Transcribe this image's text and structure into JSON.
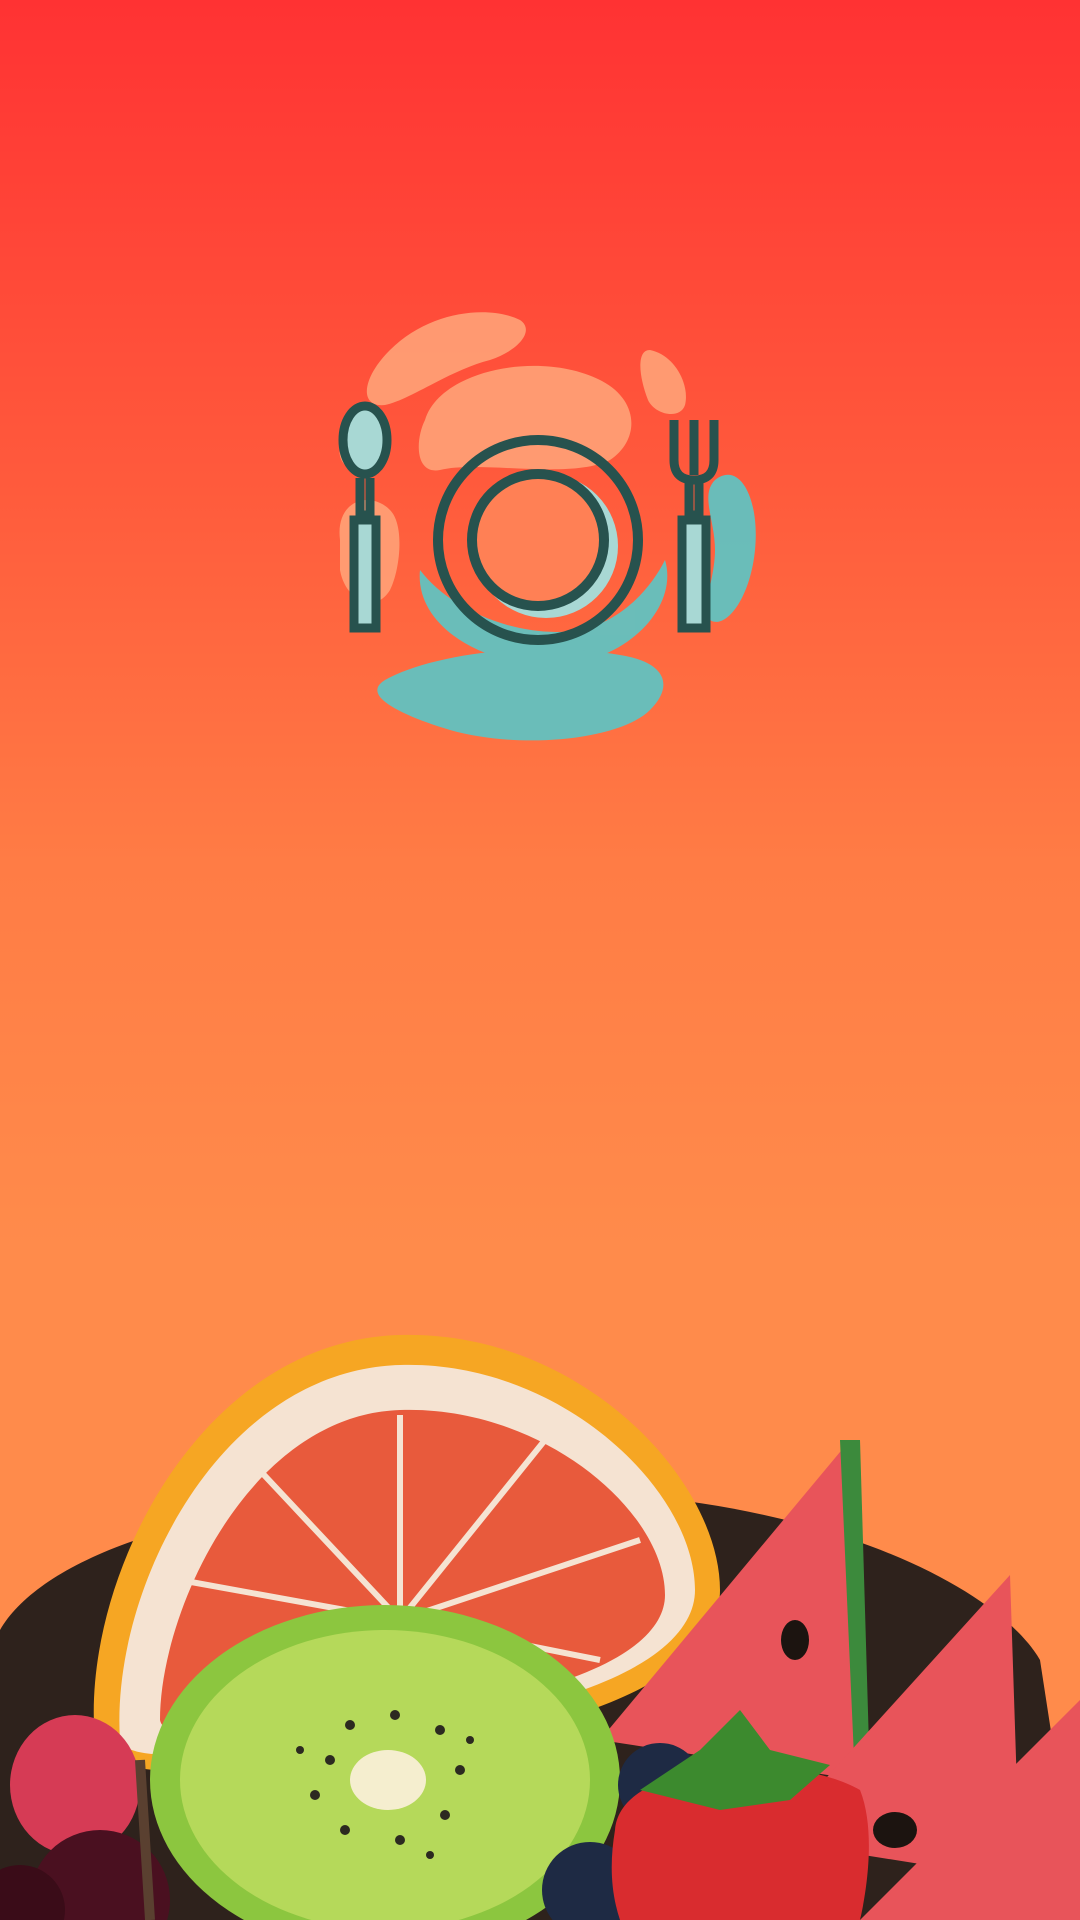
{
  "screen": {
    "type": "splash",
    "colors": {
      "gradient_top": "#FF3233",
      "gradient_bottom": "#FF8B4B",
      "blob_peach": "#FF9E74",
      "blob_teal": "#63C2C0",
      "outline": "#27524E",
      "plate_fill": "#A8D8D4"
    }
  },
  "logo": {
    "icon": "plate-fork-spoon-icon"
  },
  "illustration": {
    "icon": "fruit-bowl-image",
    "items": [
      "grapefruit",
      "kiwi",
      "watermelon",
      "strawberry",
      "raspberry",
      "blueberry",
      "cherry"
    ]
  }
}
